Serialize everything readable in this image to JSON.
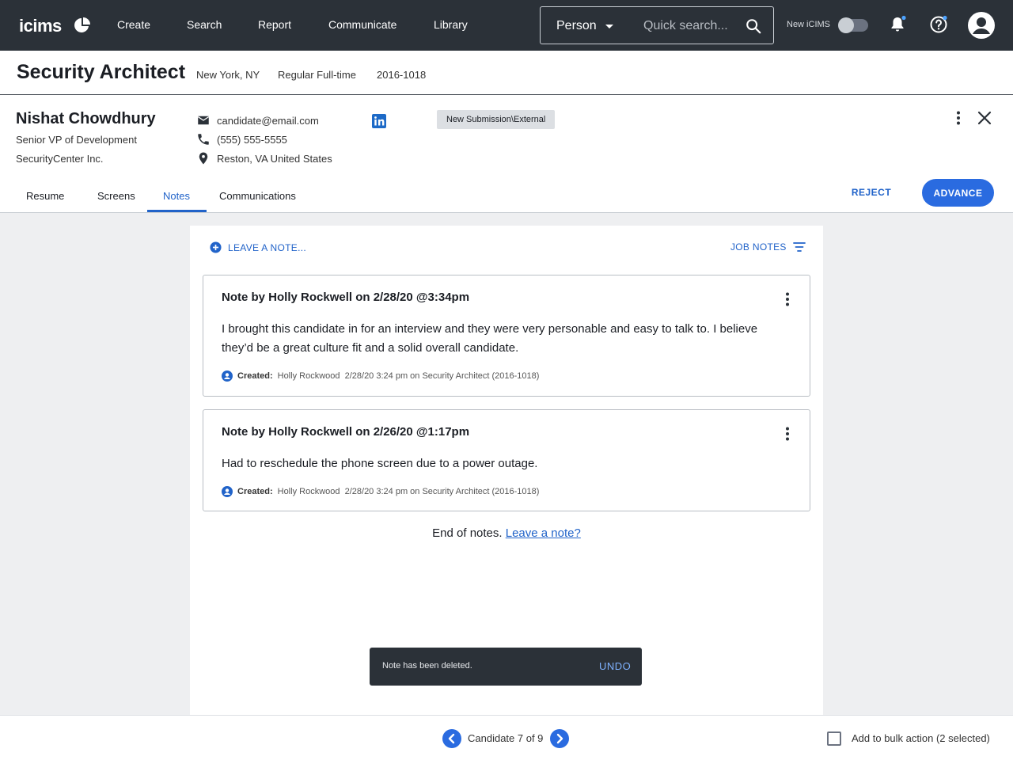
{
  "topnav": {
    "logo": "icims",
    "items": [
      "Create",
      "Search",
      "Report",
      "Communicate",
      "Library"
    ],
    "search_type": "Person",
    "search_placeholder": "Quick search...",
    "new_icims_label": "New iCIMS"
  },
  "job": {
    "title": "Security Architect",
    "location": "New York, NY",
    "employment_type": "Regular Full-time",
    "job_id": "2016-1018"
  },
  "candidate": {
    "name": "Nishat Chowdhury",
    "job_title": "Senior VP of Development",
    "company": "SecurityCenter Inc.",
    "email": "candidate@email.com",
    "phone": "(555) 555-5555",
    "location": "Reston, VA United States",
    "status": "New Submission\\External"
  },
  "tabs": [
    "Resume",
    "Screens",
    "Notes",
    "Communications"
  ],
  "active_tab": "Notes",
  "actions": {
    "reject": "REJECT",
    "advance": "ADVANCE"
  },
  "notes_panel": {
    "leave_note": "LEAVE A NOTE...",
    "job_notes": "JOB NOTES",
    "notes": [
      {
        "title": "Note by Holly Rockwell on 2/28/20 @3:34pm",
        "body": "I brought this candidate in for an interview and they were very personable and easy to talk to. I believe they’d be a great culture fit and a solid overall candidate.",
        "created_label": "Created:",
        "created_detail": "Holly Rockwood  2/28/20 3:24 pm on Security Architect (2016-1018)"
      },
      {
        "title": "Note by Holly Rockwell on 2/26/20 @1:17pm",
        "body": "Had to reschedule the phone screen due to a power outage.",
        "created_label": "Created:",
        "created_detail": "Holly Rockwood  2/28/20 3:24 pm on Security Architect (2016-1018)"
      }
    ],
    "end_text": "End of notes.",
    "end_link": "Leave a note?"
  },
  "snackbar": {
    "message": "Note has been deleted.",
    "action": "UNDO"
  },
  "footer": {
    "candidate_count": "Candidate 7 of 9",
    "bulk_label": "Add to bulk action (2 selected)"
  },
  "colors": {
    "nav_bg": "#2b3138",
    "accent": "#2163c9",
    "button_blue": "#2a6be0",
    "page_bg": "#eeeff1"
  }
}
